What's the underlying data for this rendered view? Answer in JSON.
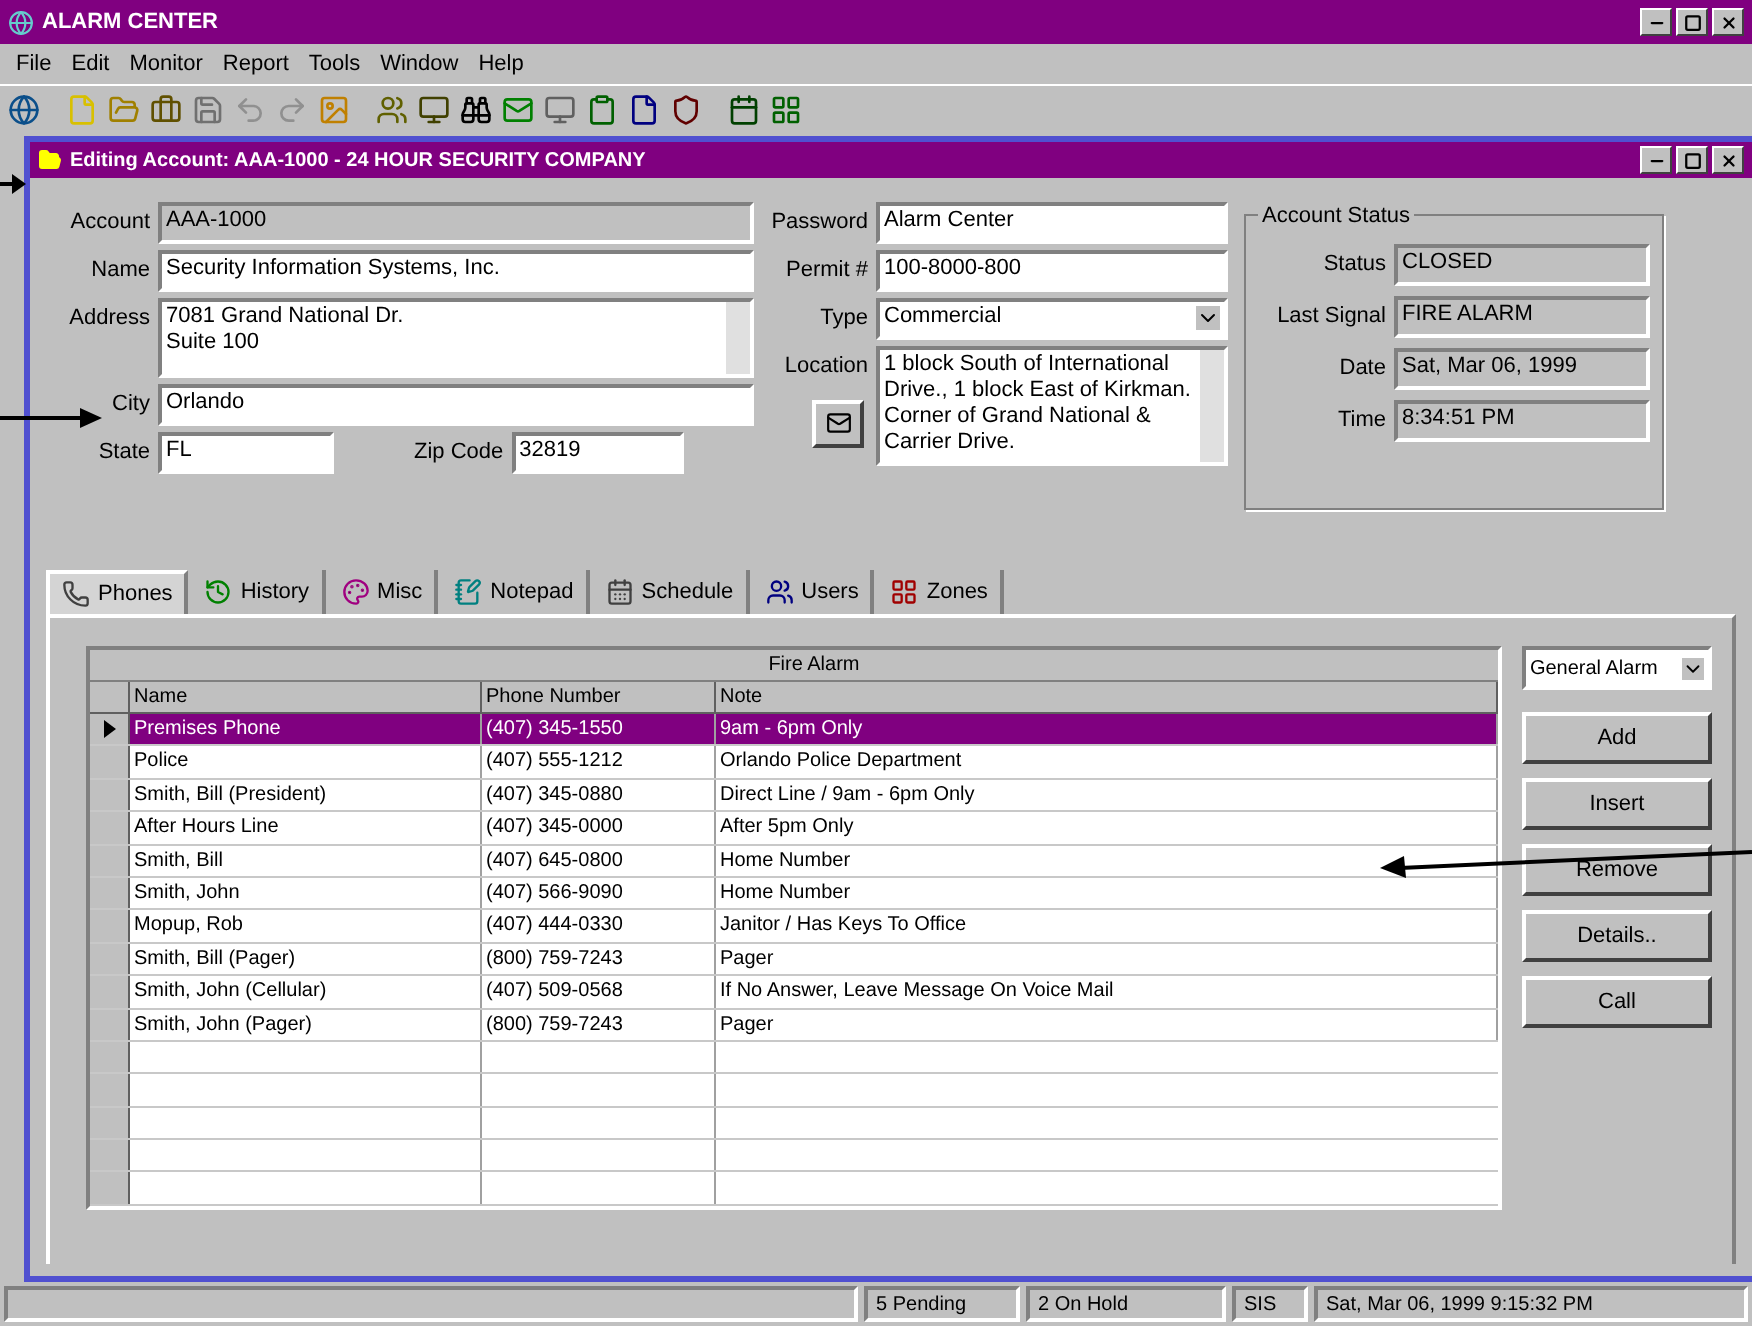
{
  "window": {
    "title": "ALARM CENTER"
  },
  "menu": [
    "File",
    "Edit",
    "Monitor",
    "Report",
    "Tools",
    "Window",
    "Help"
  ],
  "child_window": {
    "title": "Editing Account: AAA-1000  -  24 HOUR SECURITY COMPANY"
  },
  "account_form": {
    "left": [
      {
        "label": "Account",
        "value": "AAA-1000",
        "kind": "readonly"
      },
      {
        "label": "Name",
        "value": "Security Information Systems, Inc.",
        "kind": "text"
      },
      {
        "label": "Address",
        "value": "7081 Grand National Dr.\nSuite 100",
        "kind": "memo"
      },
      {
        "label": "City",
        "value": "Orlando",
        "kind": "text"
      }
    ],
    "state": {
      "label": "State",
      "value": "FL"
    },
    "zip": {
      "label": "Zip Code",
      "value": "32819"
    },
    "middle": [
      {
        "label": "Password",
        "value": "Alarm Center",
        "kind": "text"
      },
      {
        "label": "Permit #",
        "value": "100-8000-800",
        "kind": "text"
      },
      {
        "label": "Type",
        "value": "Commercial",
        "kind": "combo"
      },
      {
        "label": "Location",
        "value": "1 block South of International Drive., 1 block East of Kirkman.  Corner of Grand National & Carrier Drive.",
        "kind": "memo"
      }
    ]
  },
  "account_status": {
    "title": "Account Status",
    "fields": [
      {
        "label": "Status",
        "value": "CLOSED"
      },
      {
        "label": "Last Signal",
        "value": "FIRE ALARM"
      },
      {
        "label": "Date",
        "value": "Sat, Mar 06, 1999"
      },
      {
        "label": "Time",
        "value": "8:34:51 PM"
      }
    ]
  },
  "tabs": [
    {
      "label": "Phones",
      "selected": true
    },
    {
      "label": "History",
      "selected": false
    },
    {
      "label": "Misc",
      "selected": false
    },
    {
      "label": "Notepad",
      "selected": false
    },
    {
      "label": "Schedule",
      "selected": false
    },
    {
      "label": "Users",
      "selected": false
    },
    {
      "label": "Zones",
      "selected": false
    }
  ],
  "phones": {
    "band": "Fire Alarm",
    "columns": [
      "Name",
      "Phone Number",
      "Note"
    ],
    "rows": [
      {
        "cells": [
          "Premises Phone",
          "(407) 345-1550",
          "9am - 6pm Only"
        ],
        "selected": true
      },
      {
        "cells": [
          "Police",
          "(407) 555-1212",
          "Orlando Police Department"
        ],
        "selected": false
      },
      {
        "cells": [
          "Smith, Bill (President)",
          "(407) 345-0880",
          "Direct Line / 9am - 6pm Only"
        ],
        "selected": false
      },
      {
        "cells": [
          "After Hours Line",
          "(407) 345-0000",
          "After 5pm Only"
        ],
        "selected": false
      },
      {
        "cells": [
          "Smith, Bill",
          "(407) 645-0800",
          "Home Number"
        ],
        "selected": false
      },
      {
        "cells": [
          "Smith, John",
          "(407) 566-9090",
          "Home Number"
        ],
        "selected": false
      },
      {
        "cells": [
          "Mopup, Rob",
          "(407) 444-0330",
          "Janitor / Has Keys To Office"
        ],
        "selected": false
      },
      {
        "cells": [
          "Smith, Bill (Pager)",
          "(800) 759-7243",
          "Pager"
        ],
        "selected": false
      },
      {
        "cells": [
          "Smith, John (Cellular)",
          "(407) 509-0568",
          "If No Answer, Leave Message On Voice Mail"
        ],
        "selected": false
      },
      {
        "cells": [
          "Smith, John (Pager)",
          "(800) 759-7243",
          "Pager"
        ],
        "selected": false
      }
    ],
    "filter": "General Alarm",
    "buttons": [
      "Add",
      "Insert",
      "Remove",
      "Details..",
      "Call"
    ]
  },
  "status_bar": [
    "5 Pending",
    "2 On Hold",
    "SIS",
    "Sat, Mar 06, 1999  9:15:32 PM"
  ]
}
